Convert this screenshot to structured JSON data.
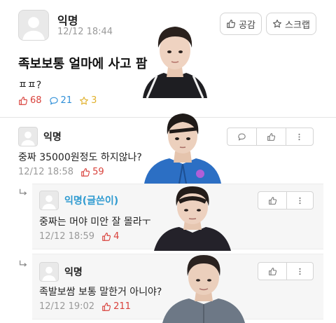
{
  "post": {
    "author": "익명",
    "time": "12/12 18:44",
    "title": "족보보통 얼마에 사고 팜",
    "body": "ㅍㅍ?",
    "likes": "68",
    "comments": "21",
    "scraps": "3",
    "like_button": "공감",
    "scrap_button": "스크랩"
  },
  "comments": [
    {
      "author": "익명",
      "text": "중짜 35000원정도 하지않나?",
      "time": "12/12 18:58",
      "likes": "59"
    },
    {
      "author": "익명(글쓴이)",
      "text": "중짜는 머야 미안 잘 몰라ㅜ",
      "time": "12/12 18:59",
      "likes": "4"
    },
    {
      "author": "익명",
      "text": "족발보쌈 보통 말한거 아니야?",
      "time": "12/12 19:02",
      "likes": "211"
    }
  ],
  "icons": {
    "like": "thumbs-up-icon",
    "comment": "speech-bubble-icon",
    "scrap": "star-icon",
    "more": "more-vertical-icon",
    "reply": "reply-arrow-icon"
  },
  "colors": {
    "like_count": "#d9423c",
    "comment_count": "#2f8fd8",
    "scrap_count": "#e1b12c",
    "author_op": "#2e9ad0"
  }
}
